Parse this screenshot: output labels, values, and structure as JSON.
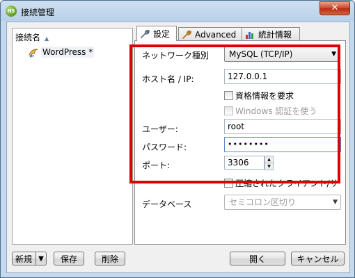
{
  "window": {
    "title": "接続管理",
    "app_icon_text": "HS",
    "close_glyph": "✕"
  },
  "sidebar": {
    "column_header": "接続名",
    "sort_icon": "▲",
    "connections": [
      {
        "label": "WordPress *"
      }
    ]
  },
  "left_buttons": {
    "new_label": "新規",
    "new_arrow": "▼",
    "save_label": "保存",
    "delete_label": "削除"
  },
  "tabs": [
    {
      "label": "設定",
      "icon": "wrench-icon"
    },
    {
      "label": "Advanced",
      "icon": "wrench-icon"
    },
    {
      "label": "統計情報",
      "icon": "chart-icon"
    }
  ],
  "settings": {
    "network_type_label": "ネットワーク種別",
    "network_type_value": "MySQL (TCP/IP)",
    "host_label": "ホスト名 / IP:",
    "host_value": "127.0.0.1",
    "require_credentials_label": "資格情報を要求",
    "windows_auth_label": "Windows 認証を使う",
    "user_label": "ユーザー:",
    "user_value": "root",
    "password_label": "パスワード:",
    "password_value": "••••••••",
    "port_label": "ポート:",
    "port_value": "3306",
    "compression_label": "圧縮されたクライアント/サ",
    "database_label": "データベース",
    "database_value": "セミコロン区切り"
  },
  "footer": {
    "open_label": "開く",
    "cancel_label": "キャンセル"
  },
  "colors": {
    "highlight_frame": "#e00000"
  }
}
